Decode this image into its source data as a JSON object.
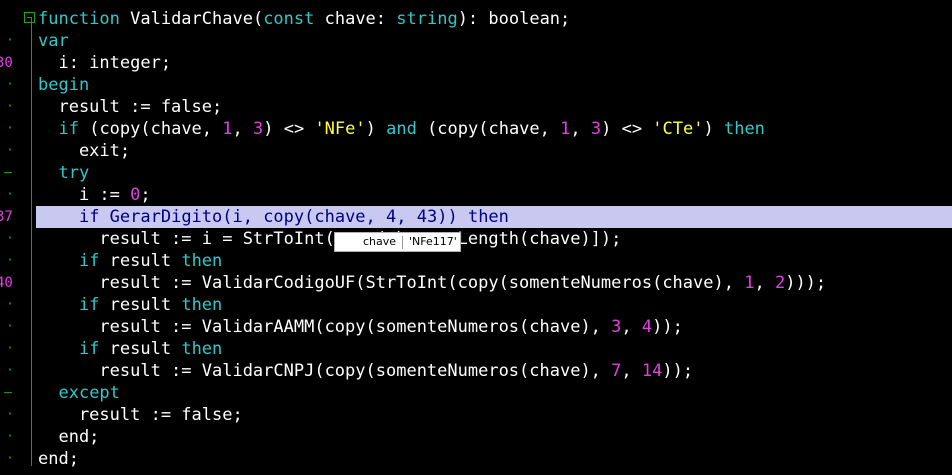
{
  "gutter": {
    "line_numbers": [
      "30",
      "37",
      "40"
    ]
  },
  "code_lines": [
    [
      {
        "t": "function",
        "c": "kw"
      },
      {
        "t": " ValidarChave(",
        "c": "pl"
      },
      {
        "t": "const",
        "c": "kw"
      },
      {
        "t": " chave: ",
        "c": "pl"
      },
      {
        "t": "string",
        "c": "kw"
      },
      {
        "t": "): boolean;",
        "c": "pl"
      }
    ],
    [
      {
        "t": "var",
        "c": "kw"
      }
    ],
    [
      {
        "t": "  i: integer;",
        "c": "pl"
      }
    ],
    [
      {
        "t": "begin",
        "c": "kw"
      }
    ],
    [
      {
        "t": "  result := false;",
        "c": "pl"
      }
    ],
    [
      {
        "t": "  ",
        "c": "pl"
      },
      {
        "t": "if",
        "c": "kw"
      },
      {
        "t": " (copy(chave, ",
        "c": "pl"
      },
      {
        "t": "1",
        "c": "num"
      },
      {
        "t": ", ",
        "c": "pl"
      },
      {
        "t": "3",
        "c": "num"
      },
      {
        "t": ") <> ",
        "c": "pl"
      },
      {
        "t": "'NFe'",
        "c": "str"
      },
      {
        "t": ") ",
        "c": "pl"
      },
      {
        "t": "and",
        "c": "kw"
      },
      {
        "t": " (copy(chave, ",
        "c": "pl"
      },
      {
        "t": "1",
        "c": "num"
      },
      {
        "t": ", ",
        "c": "pl"
      },
      {
        "t": "3",
        "c": "num"
      },
      {
        "t": ") <> ",
        "c": "pl"
      },
      {
        "t": "'CTe'",
        "c": "str"
      },
      {
        "t": ") ",
        "c": "pl"
      },
      {
        "t": "then",
        "c": "kw"
      }
    ],
    [
      {
        "t": "    exit;",
        "c": "pl"
      }
    ],
    [
      {
        "t": "  ",
        "c": "pl"
      },
      {
        "t": "try",
        "c": "kw"
      }
    ],
    [
      {
        "t": "    i := ",
        "c": "pl"
      },
      {
        "t": "0",
        "c": "num"
      },
      {
        "t": ";",
        "c": "pl"
      }
    ],
    [
      {
        "t": "    ",
        "c": "pl"
      },
      {
        "t": "if",
        "c": "kw"
      },
      {
        "t": " GerarDigito(i, copy(chave, ",
        "c": "pl"
      },
      {
        "t": "4",
        "c": "num"
      },
      {
        "t": ", ",
        "c": "pl"
      },
      {
        "t": "43",
        "c": "num"
      },
      {
        "t": ")) ",
        "c": "pl"
      },
      {
        "t": "then",
        "c": "kw"
      }
    ],
    [
      {
        "t": "      result := i = StrToInt(copy(chave, Length(chave)]);",
        "c": "pl"
      }
    ],
    [
      {
        "t": "    ",
        "c": "pl"
      },
      {
        "t": "if",
        "c": "kw"
      },
      {
        "t": " result ",
        "c": "pl"
      },
      {
        "t": "then",
        "c": "kw"
      }
    ],
    [
      {
        "t": "      result := ValidarCodigoUF(StrToInt(copy(somenteNumeros(chave), ",
        "c": "pl"
      },
      {
        "t": "1",
        "c": "num"
      },
      {
        "t": ", ",
        "c": "pl"
      },
      {
        "t": "2",
        "c": "num"
      },
      {
        "t": ")));",
        "c": "pl"
      }
    ],
    [
      {
        "t": "    ",
        "c": "pl"
      },
      {
        "t": "if",
        "c": "kw"
      },
      {
        "t": " result ",
        "c": "pl"
      },
      {
        "t": "then",
        "c": "kw"
      }
    ],
    [
      {
        "t": "      result := ValidarAAMM(copy(somenteNumeros(chave), ",
        "c": "pl"
      },
      {
        "t": "3",
        "c": "num"
      },
      {
        "t": ", ",
        "c": "pl"
      },
      {
        "t": "4",
        "c": "num"
      },
      {
        "t": "));",
        "c": "pl"
      }
    ],
    [
      {
        "t": "    ",
        "c": "pl"
      },
      {
        "t": "if",
        "c": "kw"
      },
      {
        "t": " result ",
        "c": "pl"
      },
      {
        "t": "then",
        "c": "kw"
      }
    ],
    [
      {
        "t": "      result := ValidarCNPJ(copy(somenteNumeros(chave), ",
        "c": "pl"
      },
      {
        "t": "7",
        "c": "num"
      },
      {
        "t": ", ",
        "c": "pl"
      },
      {
        "t": "14",
        "c": "num"
      },
      {
        "t": "));",
        "c": "pl"
      }
    ],
    [
      {
        "t": "  ",
        "c": "pl"
      },
      {
        "t": "except",
        "c": "kw"
      }
    ],
    [
      {
        "t": "    result := false;",
        "c": "pl"
      }
    ],
    [
      {
        "t": "  end;",
        "c": "pl"
      }
    ],
    [
      {
        "t": "end;",
        "c": "pl"
      }
    ]
  ],
  "highlighted_line": 9,
  "hint": {
    "name": "chave",
    "value": "'NFe117'"
  },
  "colors": {
    "background": "#000000",
    "keyword": "#32c8c8",
    "number": "#e040e0",
    "string": "#ffff40",
    "identifier": "#ffffff",
    "gutter": "#20a020",
    "execution_line": "#c8c8f0"
  }
}
